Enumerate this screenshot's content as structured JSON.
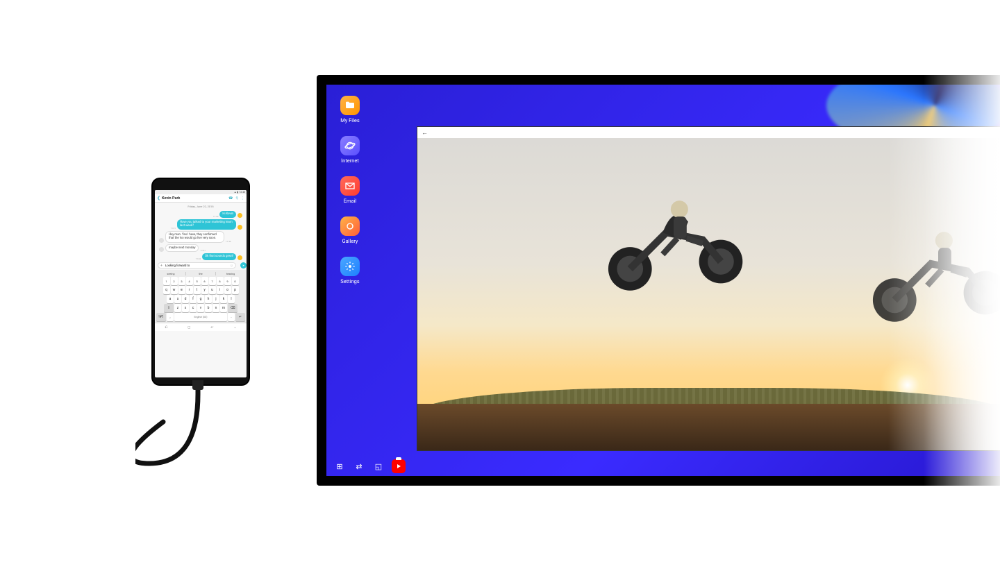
{
  "phone": {
    "status_time": "12:45",
    "contact_name": "Kevin Park",
    "date": "Friday, June 22, 2018",
    "messages": [
      {
        "dir": "out",
        "text": "Hi Kevin",
        "time": "11:30"
      },
      {
        "dir": "out",
        "text": "Have you talked to your marketing team last week?",
        "time": "11:31"
      },
      {
        "dir": "in",
        "text": "Hey man. Yes I have, they confirmed that the tvo would go live very soon.",
        "time": "11:40"
      },
      {
        "dir": "in",
        "text": "maybe next monday",
        "time": "11:41"
      },
      {
        "dir": "out",
        "text": "Ok that sounds great!",
        "time": "11:42"
      }
    ],
    "compose_value": "Looking forward to",
    "suggestions": [
      "seeing",
      "the",
      "hearing"
    ],
    "keyboard_lang": "English (US)"
  },
  "dex": {
    "apps": [
      {
        "id": "my-files",
        "label": "My Files"
      },
      {
        "id": "internet",
        "label": "Internet"
      },
      {
        "id": "email",
        "label": "Email"
      },
      {
        "id": "gallery",
        "label": "Gallery"
      },
      {
        "id": "settings",
        "label": "Settings"
      }
    ],
    "taskbar_back_arrow": "←"
  }
}
